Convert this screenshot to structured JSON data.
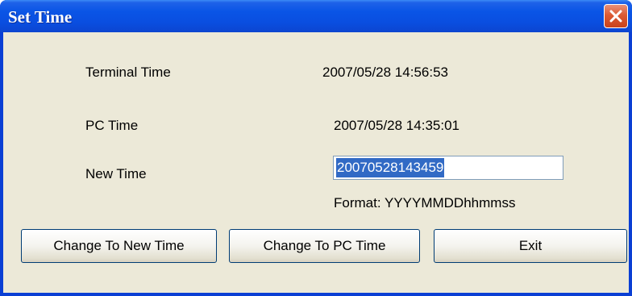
{
  "window": {
    "title": "Set Time",
    "close_icon": "close-icon",
    "close_color": "#d9502a",
    "title_color": "#0a55e6"
  },
  "fields": {
    "terminal_time_label": "Terminal Time",
    "terminal_time_value": "2007/05/28 14:56:53",
    "pc_time_label": "PC Time",
    "pc_time_value": "2007/05/28 14:35:01",
    "new_time_label": "New Time",
    "new_time_value": "20070528143459",
    "format_hint": "Format: YYYYMMDDhhmmss"
  },
  "buttons": {
    "change_new": "Change To New Time",
    "change_pc": "Change To PC Time",
    "exit": "Exit"
  }
}
